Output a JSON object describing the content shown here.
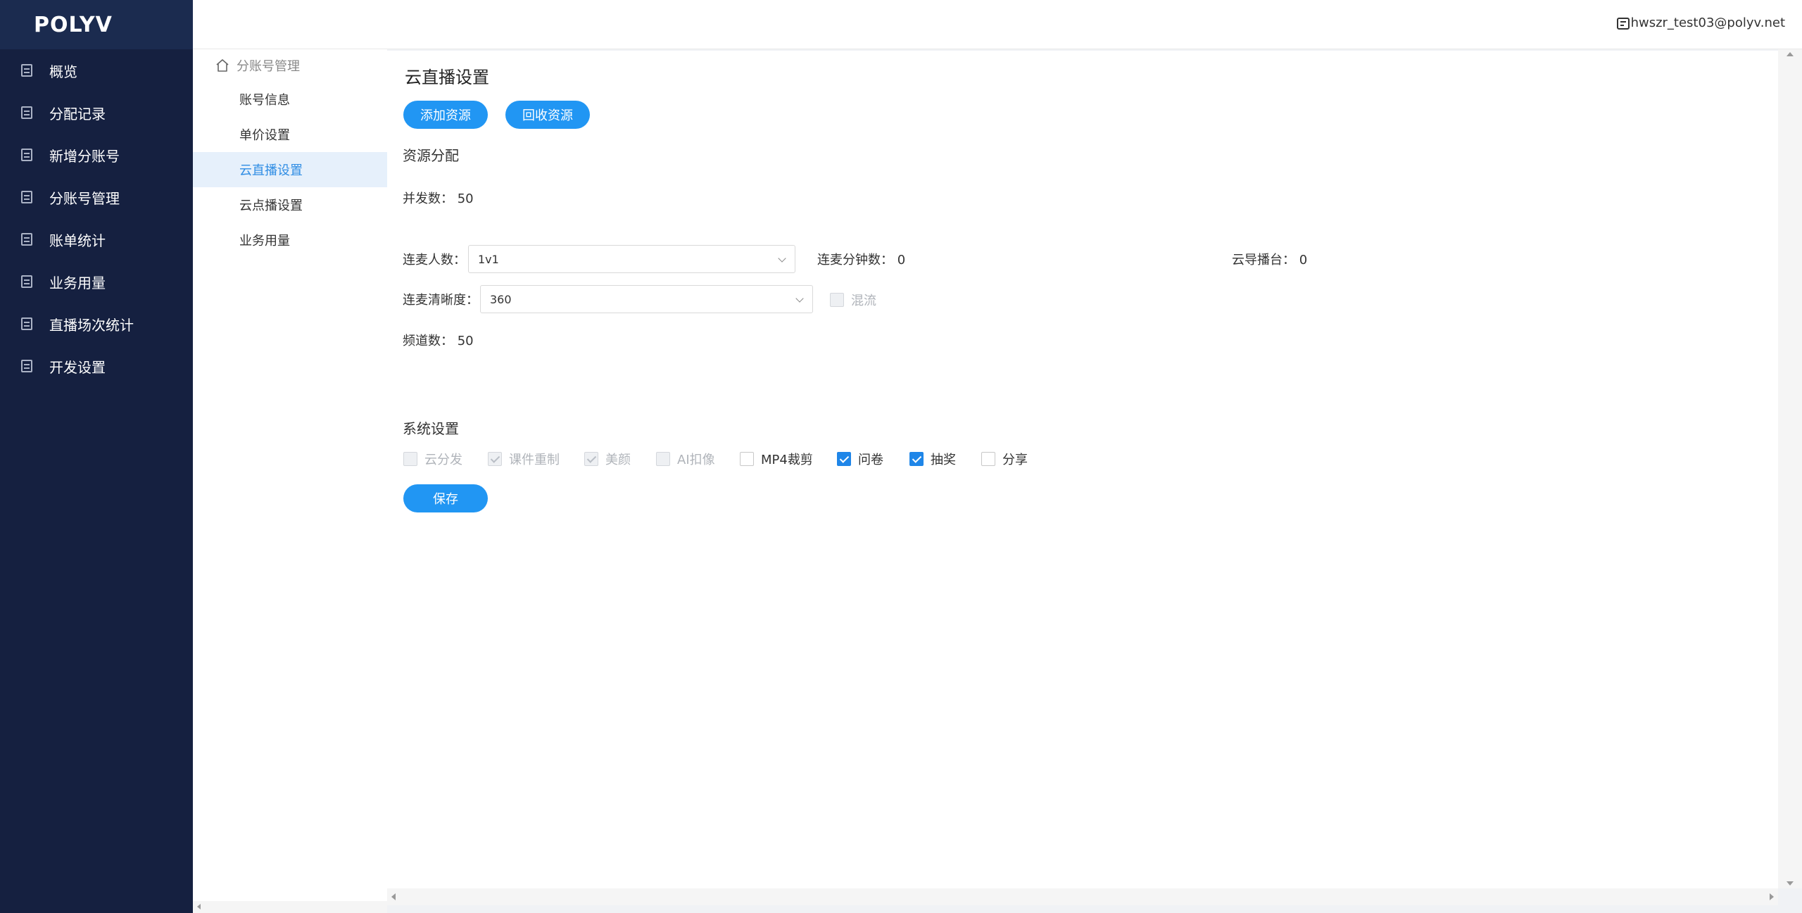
{
  "app": {
    "logo_text": "POLYV"
  },
  "sidebar": {
    "items": [
      {
        "label": "概览"
      },
      {
        "label": "分配记录"
      },
      {
        "label": "新增分账号"
      },
      {
        "label": "分账号管理"
      },
      {
        "label": "账单统计"
      },
      {
        "label": "业务用量"
      },
      {
        "label": "直播场次统计"
      },
      {
        "label": "开发设置"
      }
    ]
  },
  "header": {
    "user_email": "hwszr_test03@polyv.net"
  },
  "submenu": {
    "head": "分账号管理",
    "items": [
      {
        "label": "账号信息",
        "active": false
      },
      {
        "label": "单价设置",
        "active": false
      },
      {
        "label": "云直播设置",
        "active": true
      },
      {
        "label": "云点播设置",
        "active": false
      },
      {
        "label": "业务用量",
        "active": false
      }
    ]
  },
  "main": {
    "title": "云直播设置",
    "add_resource_label": "添加资源",
    "recycle_resource_label": "回收资源",
    "resource_section": "资源分配",
    "concurrency": "并发数： 50",
    "mic_count_label": "连麦人数：",
    "mic_count_value": "1v1",
    "mic_minutes": "连麦分钟数： 0",
    "cloud_director": "云导播台： 0",
    "mic_quality_label": "连麦清晰度：",
    "mic_quality_value": "360",
    "mix_stream_label": "混流",
    "channel_count": "频道数： 50",
    "system_section": "系统设置",
    "system_options": [
      {
        "label": "云分发",
        "checked": false,
        "disabled": true
      },
      {
        "label": "课件重制",
        "checked": true,
        "disabled": true
      },
      {
        "label": "美颜",
        "checked": true,
        "disabled": true
      },
      {
        "label": "AI扣像",
        "checked": false,
        "disabled": true
      },
      {
        "label": "MP4裁剪",
        "checked": false,
        "disabled": false
      },
      {
        "label": "问卷",
        "checked": true,
        "disabled": false
      },
      {
        "label": "抽奖",
        "checked": true,
        "disabled": false
      },
      {
        "label": "分享",
        "checked": false,
        "disabled": false
      }
    ],
    "save_label": "保存"
  },
  "colors": {
    "sidebar_bg": "#152040",
    "accent": "#2196f3",
    "active_submenu_bg": "#e6f0fb"
  }
}
